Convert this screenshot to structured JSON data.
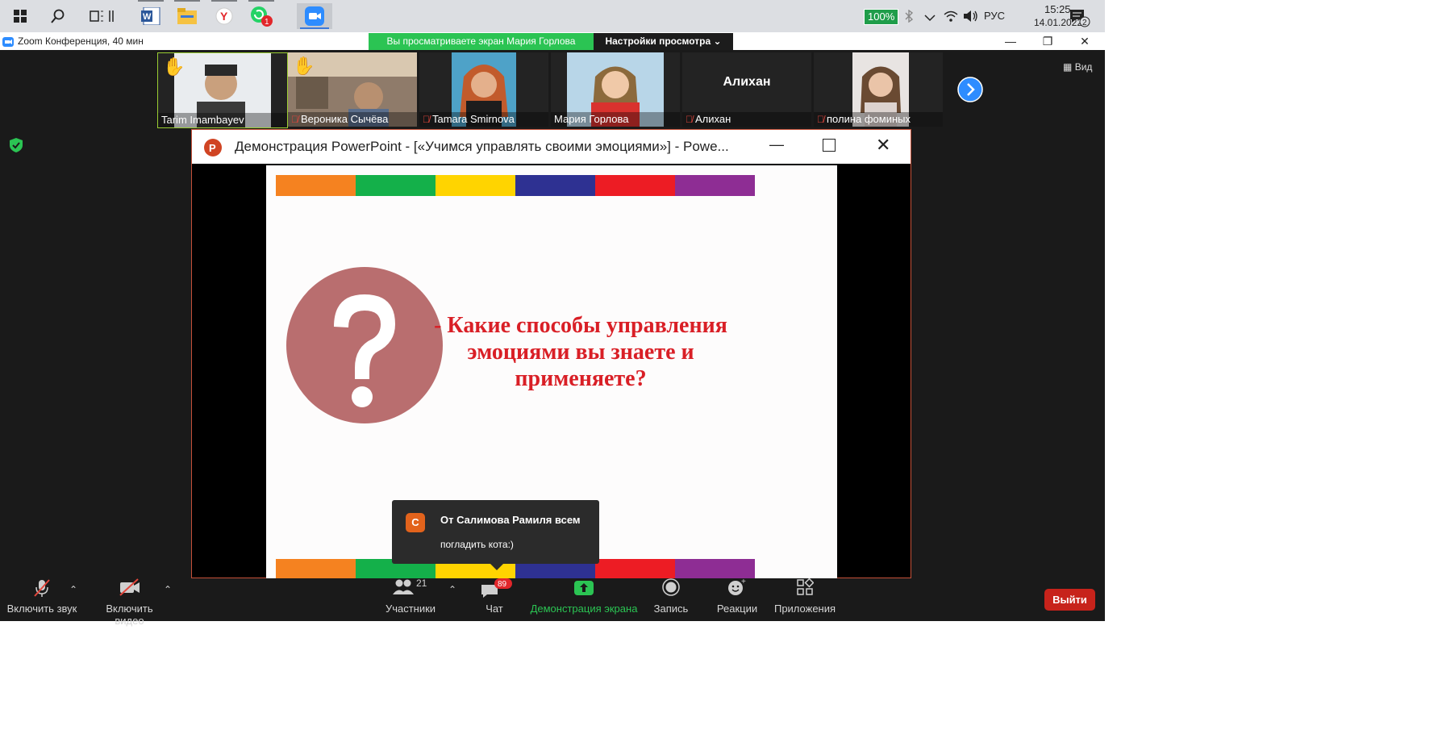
{
  "taskbar": {
    "battery": "100%",
    "language": "РУС",
    "time": "15:25",
    "date": "14.01.2022",
    "whatsapp_badge": "1",
    "notifications_badge": "2"
  },
  "zoom": {
    "window_title": "Zoom Конференция, 40 мин",
    "viewing_banner": "Вы просматриваете экран Мария Горлова",
    "view_settings": "Настройки просмотра",
    "view_button": "Вид"
  },
  "participants": [
    {
      "name": "Tarim Imambayev",
      "hand": true,
      "muted": false
    },
    {
      "name": "Вероника Сычёва",
      "hand": true,
      "muted": true
    },
    {
      "name": "Tamara Smirnova",
      "hand": false,
      "muted": true
    },
    {
      "name": "Мария Горлова",
      "hand": false,
      "muted": false
    },
    {
      "name": "Алихан",
      "hand": false,
      "muted": true,
      "center_name": "Алихан"
    },
    {
      "name": "полина фоминых",
      "hand": false,
      "muted": true
    }
  ],
  "ppt": {
    "title": "Демонстрация PowerPoint - [«Учимся управлять своими эмоциями»] - Powe...",
    "slide_text_line1": "- Какие способы управления",
    "slide_text_line2": "эмоциями вы знаете и",
    "slide_text_line3": "применяете?",
    "stripe_colors": [
      "#f58220",
      "#14b04a",
      "#ffd400",
      "#2e3192",
      "#ed1c24",
      "#8e2d94"
    ]
  },
  "chat_popup": {
    "avatar_letter": "С",
    "title": "От Салимова Рамиля всем",
    "message": "погладить кота:)"
  },
  "toolbar": {
    "unmute": "Включить звук",
    "start_video": "Включить видео",
    "participants": "Участники",
    "participants_count": "21",
    "chat": "Чат",
    "chat_badge": "89",
    "share_screen": "Демонстрация экрана",
    "record": "Запись",
    "reactions": "Реакции",
    "apps": "Приложения",
    "leave": "Выйти"
  },
  "colors": {
    "zoom_green": "#2bc453",
    "leave_red": "#c7231b",
    "slide_text_red": "#d91f26",
    "question_circle": "#b96e6f"
  }
}
